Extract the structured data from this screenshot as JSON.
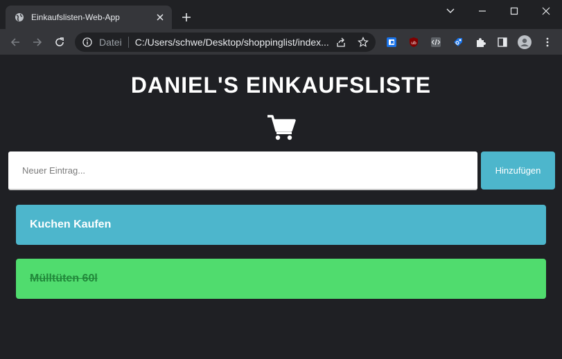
{
  "browser": {
    "tab_title": "Einkaufslisten-Web-App",
    "url_scheme": "Datei",
    "url": "C:/Users/schwe/Desktop/shoppinglist/index...",
    "icons": {
      "tab": "globe-icon",
      "close": "close-icon",
      "new_tab": "plus-icon",
      "back": "back-arrow-icon",
      "forward": "forward-arrow-icon",
      "reload": "reload-icon",
      "info": "info-icon",
      "share": "share-icon",
      "bookmark": "star-icon",
      "extensions": [
        "bookmark-extension-icon",
        "ublock-icon",
        "code-extension-icon",
        "tag-extension-icon",
        "puzzle-icon",
        "sidepanel-icon",
        "profile-icon",
        "more-vertical-icon"
      ]
    }
  },
  "app": {
    "title": "DANIEL'S EINKAUFSLISTE",
    "cart_icon": "shopping-cart-icon",
    "input_placeholder": "Neuer Eintrag...",
    "add_button": "Hinzufügen",
    "items": [
      {
        "label": "Kuchen Kaufen",
        "done": false
      },
      {
        "label": "Mülltüten 60l",
        "done": true
      }
    ]
  },
  "colors": {
    "page_bg": "#1f2024",
    "accent": "#4db6cc",
    "done_bg": "#50dc6e",
    "done_text": "#21883a"
  }
}
